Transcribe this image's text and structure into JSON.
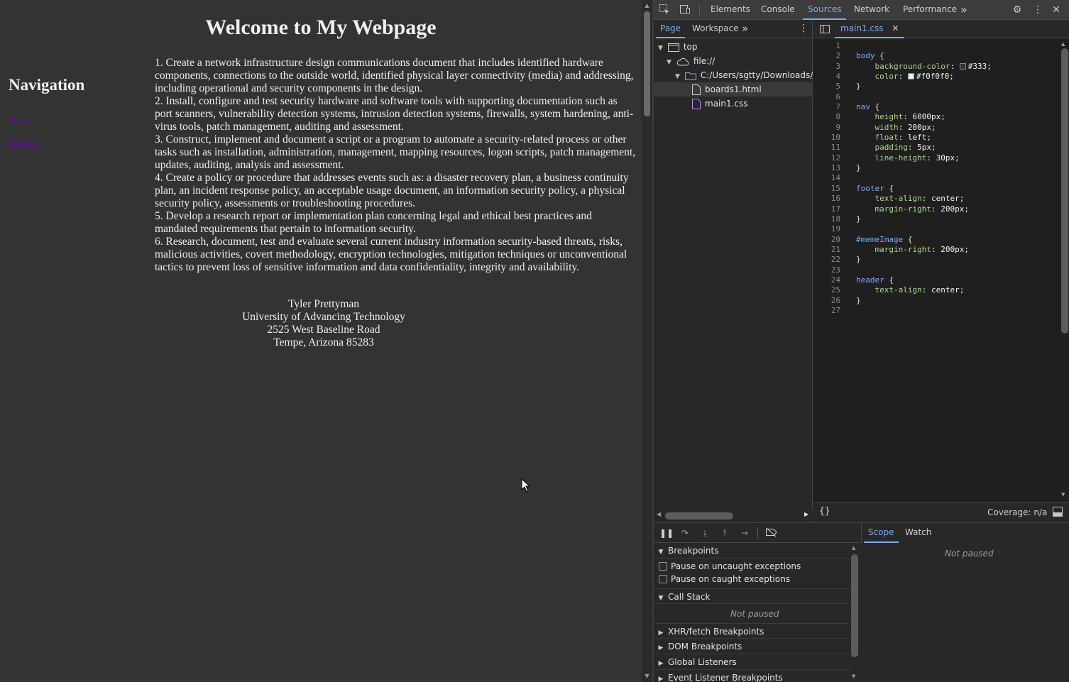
{
  "page": {
    "title": "Welcome to My Webpage",
    "nav_heading": "Navigation",
    "nav_links": [
      "Home",
      "Boards"
    ],
    "items": [
      "1. Create a network infrastructure design communications document that includes identified hardware components, connections to the outside world, identified physical layer connectivity (media) and addressing, including operational and security components in the design.",
      "2. Install, configure and test security hardware and software tools with supporting documentation such as port scanners, vulnerability detection systems, intrusion detection systems, firewalls, system hardening, anti-virus tools, patch management, auditing and assessment.",
      "3. Construct, implement and document a script or a program to automate a security-related process or other tasks such as installation, administration, management, mapping resources, logon scripts, patch management, updates, auditing, analysis and assessment.",
      "4. Create a policy or procedure that addresses events such as: a disaster recovery plan, a business continuity plan, an incident response policy, an acceptable usage document, an information security policy, a physical security policy, assessments or troubleshooting procedures.",
      "5. Develop a research report or implementation plan concerning legal and ethical best practices and mandated requirements that pertain to information security.",
      "6. Research, document, test and evaluate several current industry information security-based threats, risks, malicious activities, covert methodology, encryption technologies, mitigation techniques or unconventional tactics to prevent loss of sensitive information and data confidentiality, integrity and availability."
    ],
    "footer": [
      "Tyler Prettyman",
      "University of Advancing Technology",
      "2525 West Baseline Road",
      "Tempe, Arizona 85283"
    ]
  },
  "devtools": {
    "tabs": [
      "Elements",
      "Console",
      "Sources",
      "Network",
      "Performance"
    ],
    "active_tab": "Sources",
    "more": "»",
    "nav_tabs": [
      "Page",
      "Workspace"
    ],
    "tree": {
      "top": "top",
      "origin": "file://",
      "folder": "C:/Users/sgtty/Downloads/CSC",
      "files": [
        "boards1.html",
        "main1.css"
      ]
    },
    "editor_tab": "main1.css",
    "code_lines": [
      "",
      "body {",
      "    background-color: #333;",
      "    color: #f0f0f0;",
      "}",
      "",
      "nav {",
      "    height: 6000px;",
      "    width: 200px;",
      "    float: left;",
      "    padding: 5px;",
      "    line-height: 30px;",
      "}",
      "",
      "footer {",
      "    text-align: center;",
      "    margin-right: 200px;",
      "}",
      "",
      "#memeImage {",
      "    margin-right: 200px;",
      "}",
      "",
      "header {",
      "    text-align: center;",
      "}",
      ""
    ],
    "coverage": "Coverage: n/a",
    "sections": {
      "breakpoints": "Breakpoints",
      "pause_uncaught": "Pause on uncaught exceptions",
      "pause_caught": "Pause on caught exceptions",
      "call_stack": "Call Stack",
      "not_paused": "Not paused",
      "xhr": "XHR/fetch Breakpoints",
      "dom": "DOM Breakpoints",
      "global": "Global Listeners",
      "event": "Event Listener Breakpoints"
    },
    "scope_tabs": [
      "Scope",
      "Watch"
    ],
    "scope_status": "Not paused"
  },
  "colors": {
    "page_bg": "#333333",
    "page_text": "#f0f0f0",
    "accent": "#7cacf8",
    "css_selector": "#7cacf8",
    "css_property": "#b0d790"
  }
}
